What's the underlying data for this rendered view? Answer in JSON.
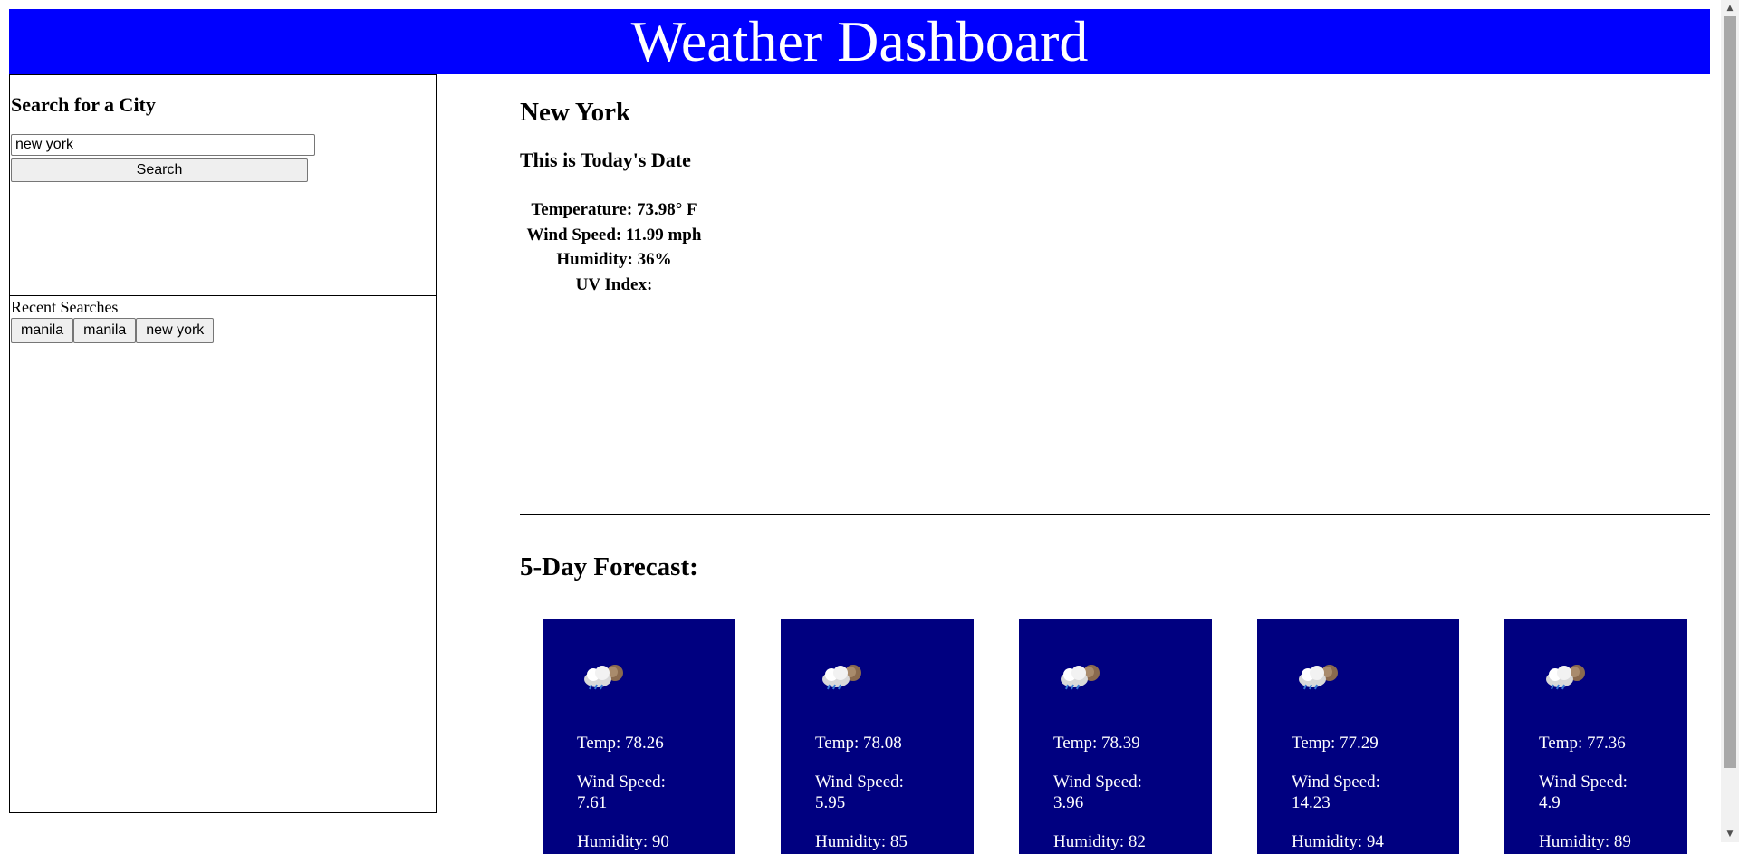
{
  "header": {
    "title": "Weather Dashboard"
  },
  "search": {
    "heading": "Search for a City",
    "input_value": "new york",
    "button_label": "Search"
  },
  "recent": {
    "title": "Recent Searches",
    "items": [
      "manila",
      "manila",
      "new york"
    ]
  },
  "current": {
    "city": "New York",
    "date": "This is Today's Date",
    "temperature": "Temperature: 73.98° F",
    "wind": "Wind Speed: 11.99 mph",
    "humidity": "Humidity: 36%",
    "uv": "UV Index:"
  },
  "forecast": {
    "title": "5-Day Forecast:",
    "cards": [
      {
        "icon": "rain-cloud-icon",
        "temp": "Temp: 78.26",
        "wind_label": "Wind Speed:",
        "wind_value": "7.61",
        "humidity": "Humidity: 90"
      },
      {
        "icon": "rain-cloud-icon",
        "temp": "Temp: 78.08",
        "wind_label": "Wind Speed:",
        "wind_value": "5.95",
        "humidity": "Humidity: 85"
      },
      {
        "icon": "rain-cloud-icon",
        "temp": "Temp: 78.39",
        "wind_label": "Wind Speed:",
        "wind_value": "3.96",
        "humidity": "Humidity: 82"
      },
      {
        "icon": "rain-cloud-icon",
        "temp": "Temp: 77.29",
        "wind_label": "Wind Speed:",
        "wind_value": "14.23",
        "humidity": "Humidity: 94"
      },
      {
        "icon": "rain-cloud-icon",
        "temp": "Temp: 77.36",
        "wind_label": "Wind Speed:",
        "wind_value": "4.9",
        "humidity": "Humidity: 89"
      }
    ]
  },
  "colors": {
    "header_bg": "#0000ff",
    "card_bg": "#000080"
  }
}
